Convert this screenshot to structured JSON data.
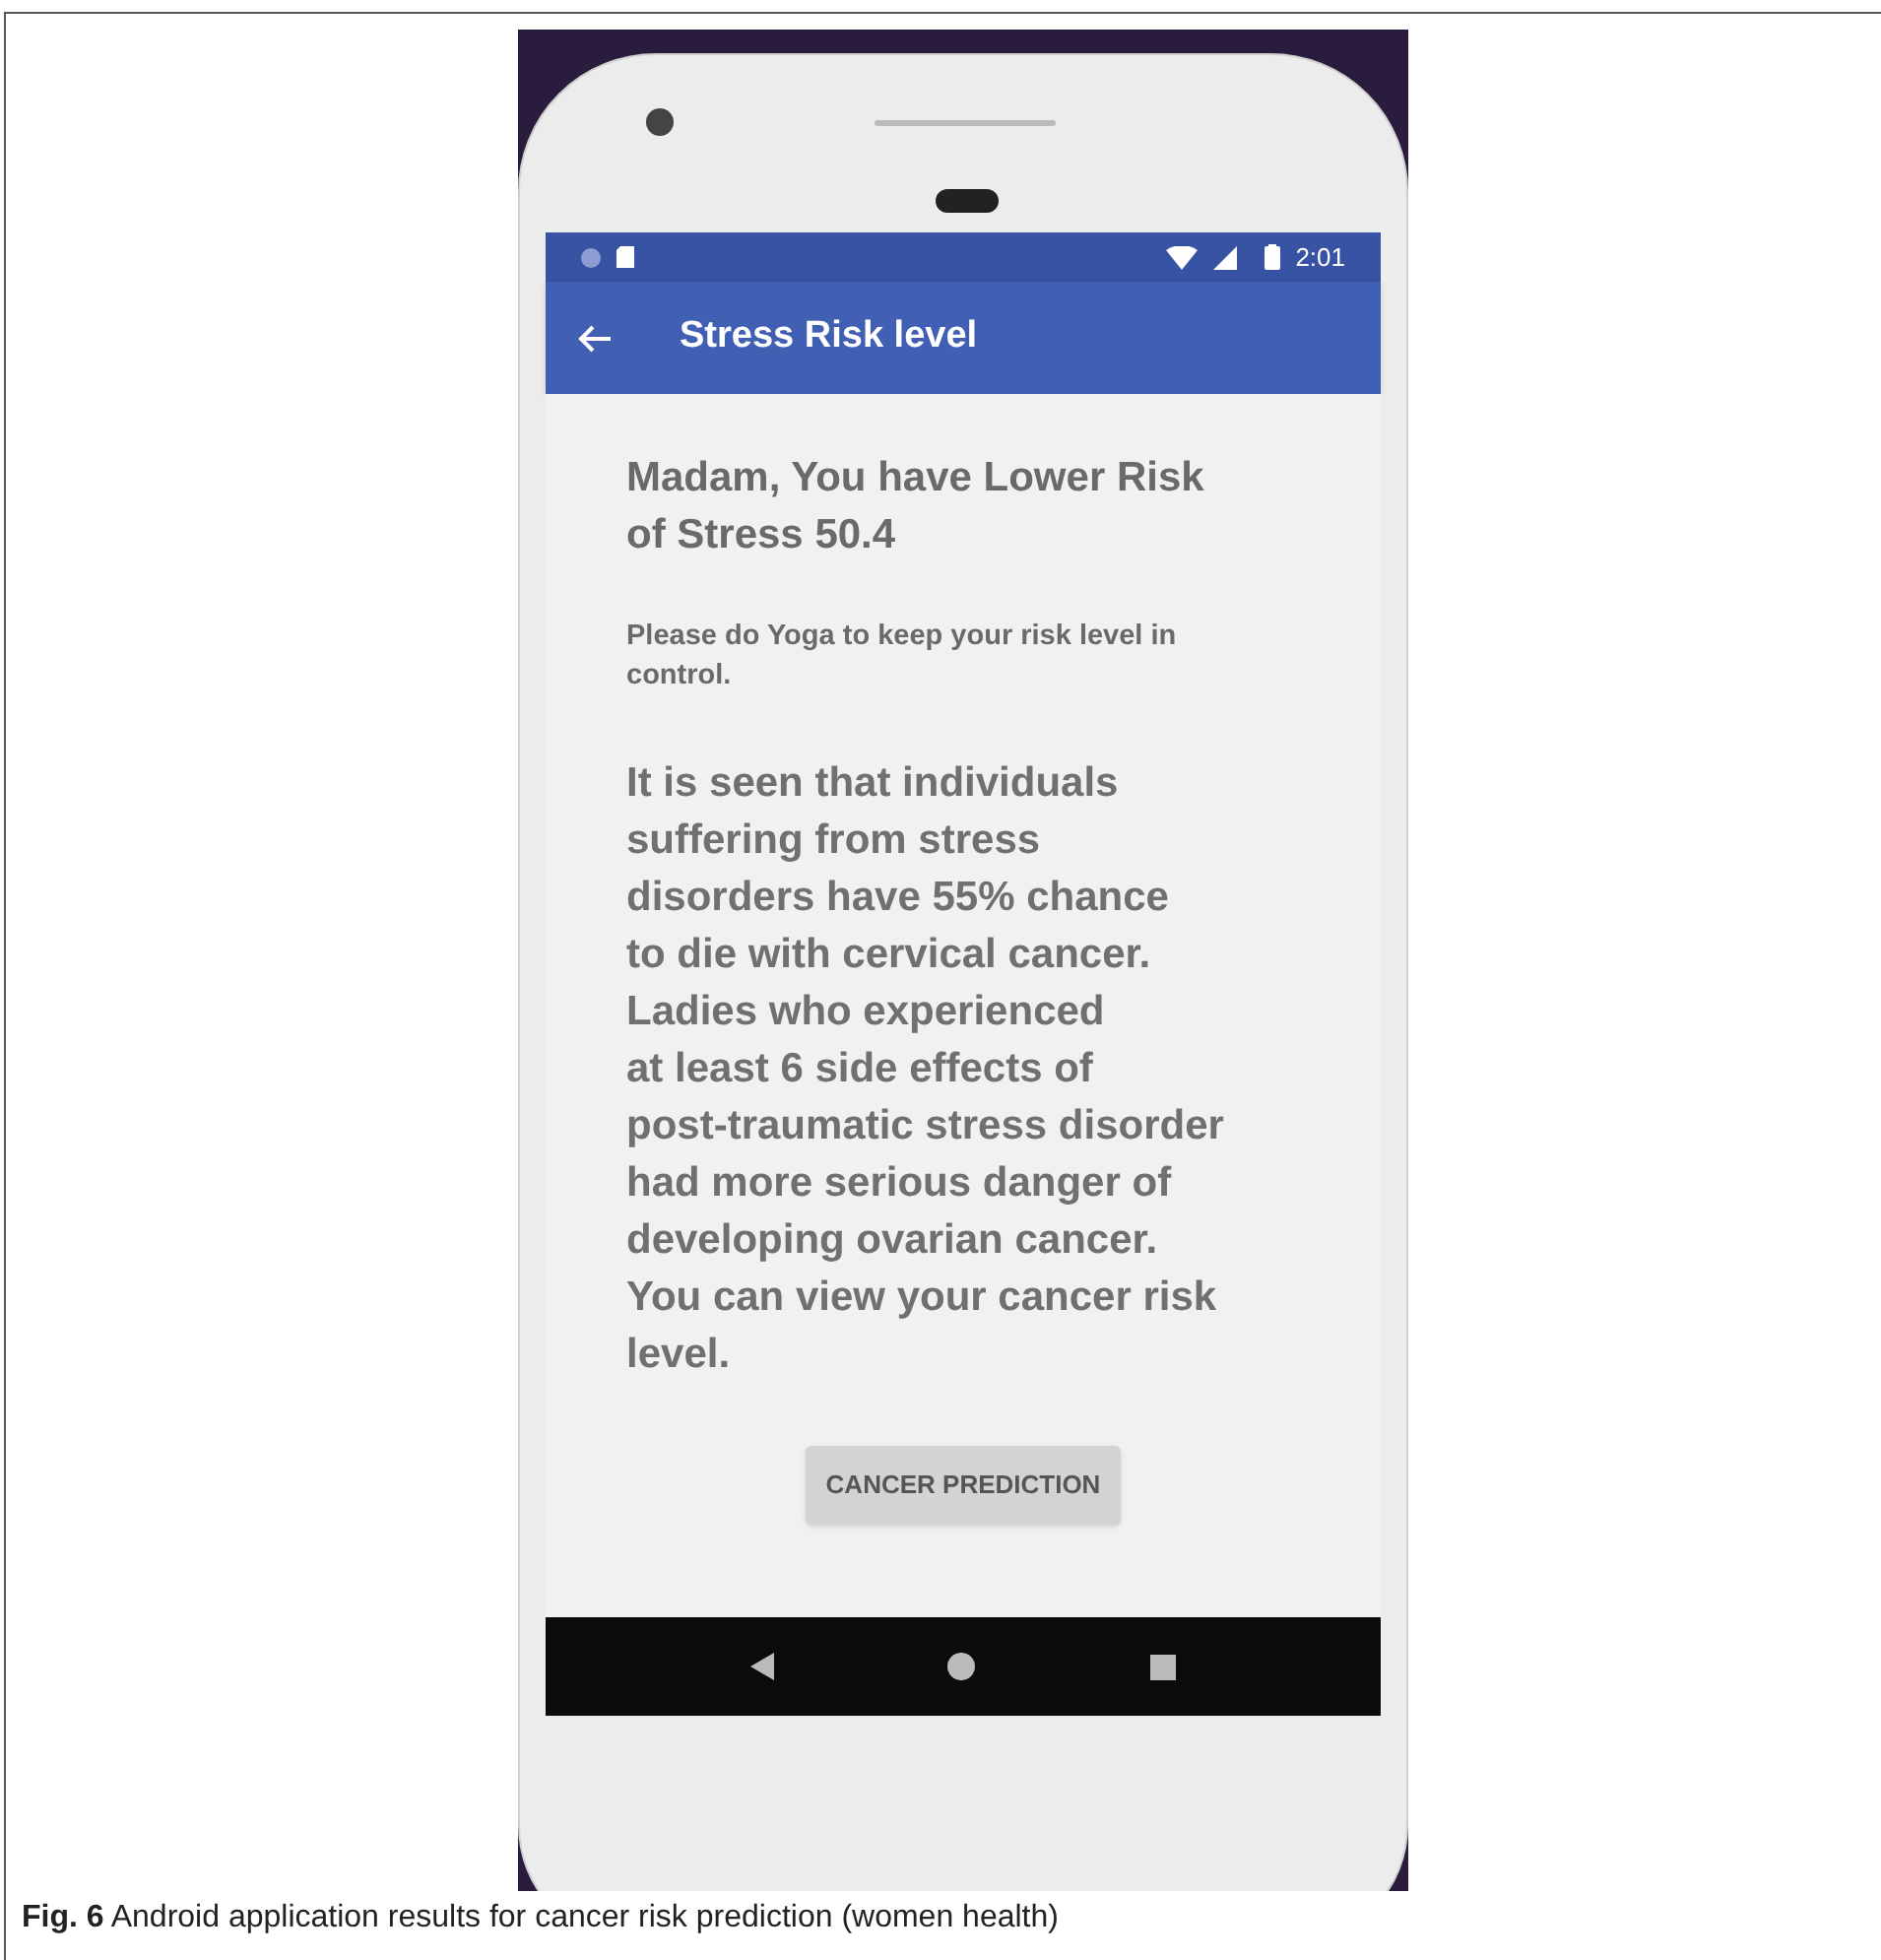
{
  "status_bar": {
    "time": "2:01"
  },
  "app_bar": {
    "title": "Stress Risk level"
  },
  "content": {
    "heading": "Madam, You have Lower Risk\nof Stress 50.4",
    "advice": "Please do Yoga to keep your risk level in\ncontrol.",
    "info": "It is seen that individuals\nsuffering from stress\ndisorders have 55% chance\nto die with cervical cancer.\nLadies who experienced\nat least 6 side effects of\npost-traumatic stress disorder\nhad more serious danger of\ndeveloping ovarian cancer.\nYou can view your cancer risk\nlevel."
  },
  "button": {
    "label": "CANCER PREDICTION"
  },
  "caption": "**Fig. 6**  Android application results for cancer risk prediction (women health)"
}
